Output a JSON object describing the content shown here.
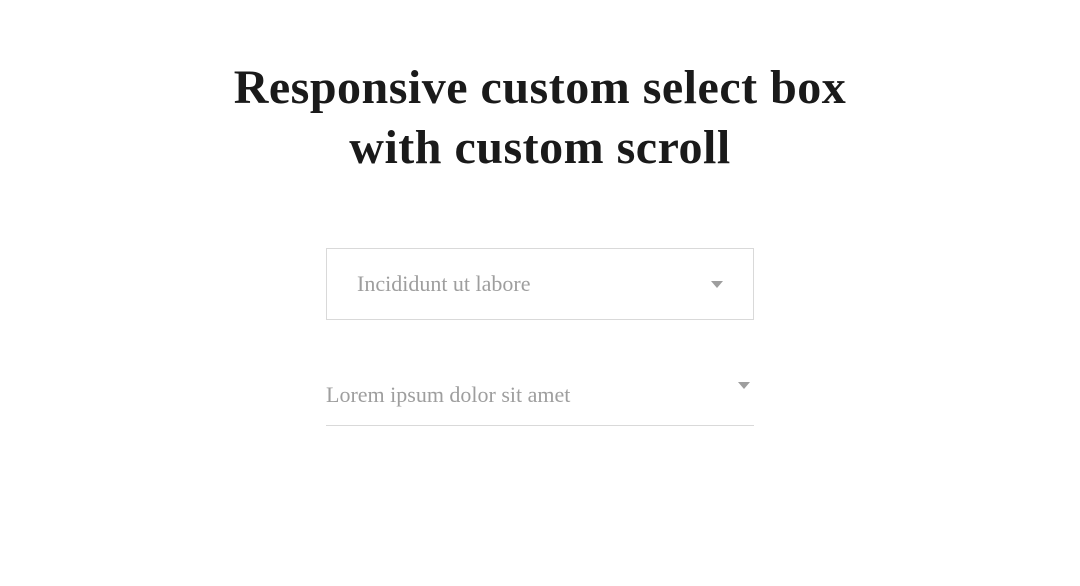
{
  "title": "Responsive custom select box with custom scroll",
  "selects": {
    "first": {
      "value": "Incididunt ut labore"
    },
    "second": {
      "value": "Lorem ipsum dolor sit amet"
    }
  }
}
